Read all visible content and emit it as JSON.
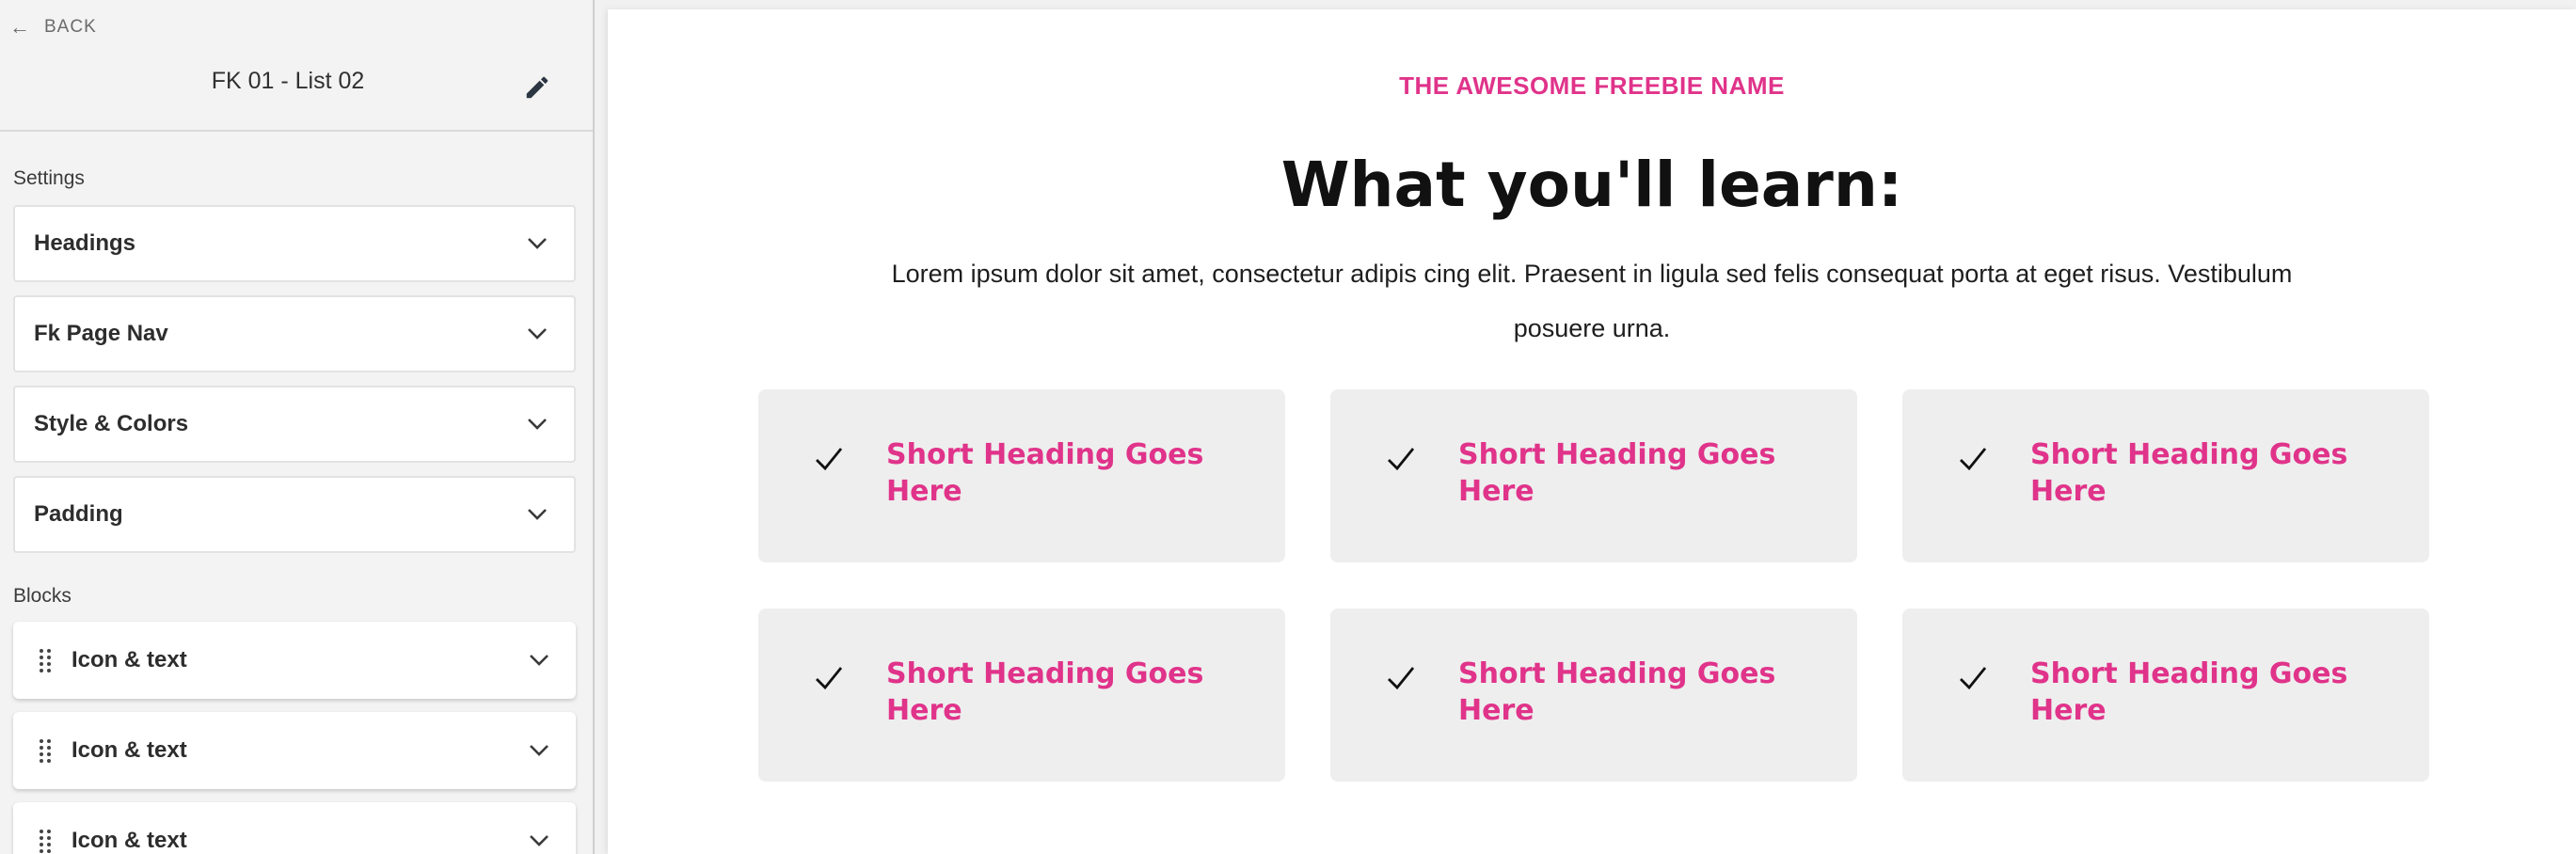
{
  "sidebar": {
    "back_label": "BACK",
    "section_title": "FK 01 - List 02",
    "settings_label": "Settings",
    "settings": [
      {
        "label": "Headings"
      },
      {
        "label": "Fk Page Nav"
      },
      {
        "label": "Style & Colors"
      },
      {
        "label": "Padding"
      }
    ],
    "blocks_label": "Blocks",
    "blocks": [
      {
        "label": "Icon & text"
      },
      {
        "label": "Icon & text"
      },
      {
        "label": "Icon & text"
      }
    ]
  },
  "preview": {
    "eyebrow": "THE AWESOME FREEBIE NAME",
    "heading": "What you'll learn:",
    "intro": "Lorem ipsum dolor sit amet, consectetur adipis cing elit. Praesent in ligula sed felis consequat porta at eget risus. Vestibulum posuere urna.",
    "cards": [
      {
        "title": "Short Heading Goes Here"
      },
      {
        "title": "Short Heading Goes Here"
      },
      {
        "title": "Short Heading Goes Here"
      },
      {
        "title": "Short Heading Goes Here"
      },
      {
        "title": "Short Heading Goes Here"
      },
      {
        "title": "Short Heading Goes Here"
      }
    ]
  },
  "colors": {
    "accent": "#e0338a",
    "card_bg": "#eeeeee",
    "sidebar_bg": "#f3f3f3"
  },
  "icons": {
    "back": "arrow-left-icon",
    "edit": "pencil-icon",
    "expand": "chevron-down-icon",
    "drag": "drag-handle-icon",
    "card": "checkmark-icon"
  }
}
